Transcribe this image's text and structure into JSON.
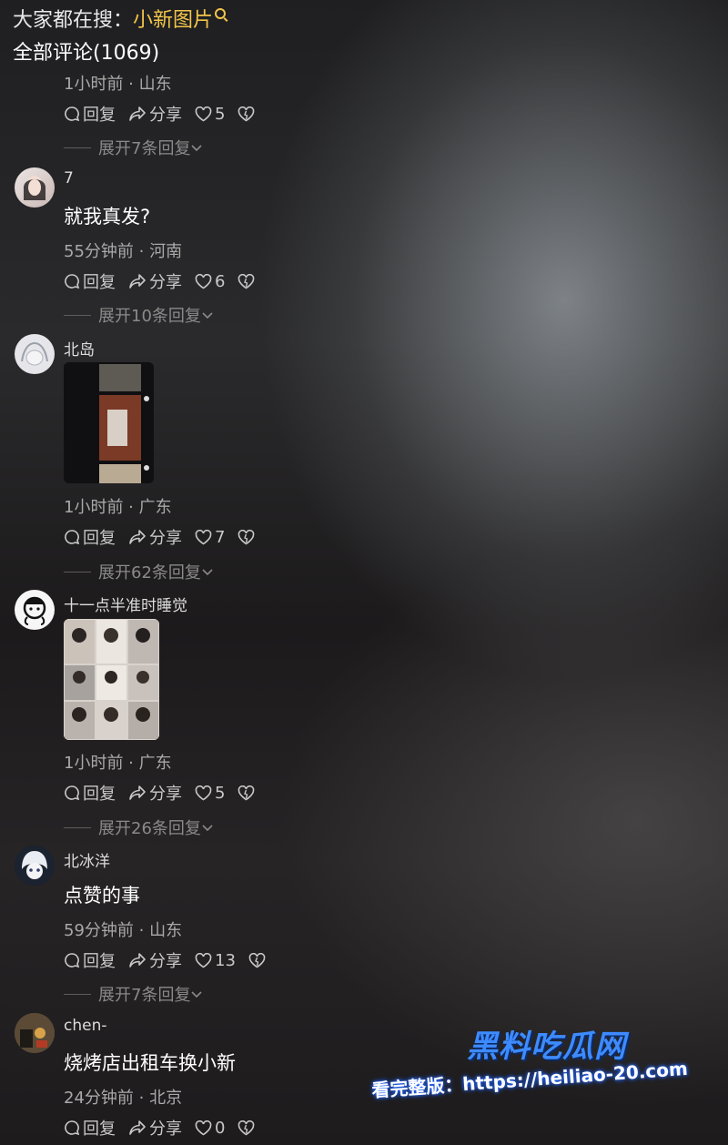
{
  "header": {
    "search_prefix": "大家都在搜：",
    "search_hot": "小新图片",
    "comments_title": "全部评论(1069)"
  },
  "labels": {
    "reply": "回复",
    "share": "分享"
  },
  "comments": [
    {
      "user": "",
      "text": "",
      "time": "1小时前 · 山东",
      "likes": "5",
      "expand": "展开7条回复"
    },
    {
      "user": "7",
      "text": "就我真发?",
      "time": "55分钟前 · 河南",
      "likes": "6",
      "expand": "展开10条回复"
    },
    {
      "user": "北岛",
      "text": "",
      "time": "1小时前 · 广东",
      "likes": "7",
      "expand": "展开62条回复"
    },
    {
      "user": "十一点半准时睡觉",
      "text": "",
      "time": "1小时前 · 广东",
      "likes": "5",
      "expand": "展开26条回复"
    },
    {
      "user": "北冰洋",
      "text": "点赞的事",
      "time": "59分钟前 · 山东",
      "likes": "13",
      "expand": "展开7条回复"
    },
    {
      "user": "chen-",
      "text": "烧烤店出租车换小新",
      "time": "24分钟前 · 北京",
      "likes": "0",
      "expand": ""
    }
  ],
  "watermark": {
    "brand": "黑料吃瓜网",
    "url": "看完整版：https://heiliao-20.com"
  },
  "colors": {
    "accent": "#f3c54a",
    "watermark_blue": "#3d8bff"
  }
}
